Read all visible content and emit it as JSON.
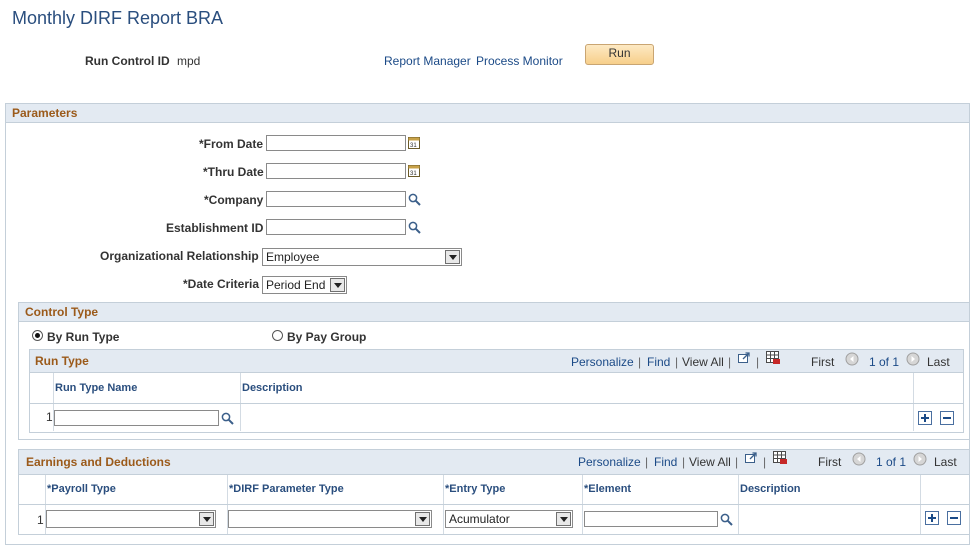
{
  "page": {
    "title": "Monthly DIRF Report BRA"
  },
  "run_control": {
    "label": "Run Control ID",
    "value": "mpd"
  },
  "links": {
    "report_manager": "Report Manager",
    "process_monitor": "Process Monitor"
  },
  "run_button": {
    "label": "Run"
  },
  "parameters": {
    "title": "Parameters",
    "from_date_label": "*From Date",
    "thru_date_label": "*Thru Date",
    "company_label": "*Company",
    "establishment_label": "Establishment ID",
    "org_rel_label": "Organizational Relationship",
    "org_rel_value": "Employee",
    "date_criteria_label": "*Date Criteria",
    "date_criteria_value": "Period End"
  },
  "control_type": {
    "title": "Control Type",
    "by_run_type": "By Run Type",
    "by_pay_group": "By Pay Group",
    "selected": "By Run Type"
  },
  "run_type_grid": {
    "title": "Run Type",
    "personalize": "Personalize",
    "find": "Find",
    "view_all": "View All",
    "first": "First",
    "page": "1 of 1",
    "last": "Last",
    "columns": [
      "Run Type Name",
      "Description"
    ],
    "row_number": "1"
  },
  "earnings_grid": {
    "title": "Earnings and Deductions",
    "personalize": "Personalize",
    "find": "Find",
    "view_all": "View All",
    "first": "First",
    "page": "1 of 1",
    "last": "Last",
    "columns": [
      "*Payroll Type",
      "*DIRF Parameter Type",
      "*Entry Type",
      "*Element",
      "Description"
    ],
    "row_number": "1",
    "entry_type_value": "Acumulator"
  }
}
